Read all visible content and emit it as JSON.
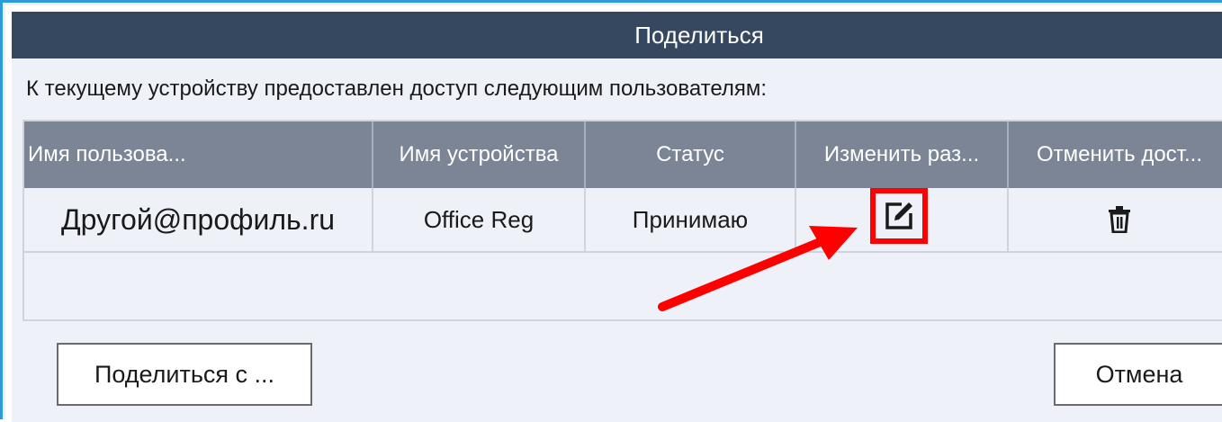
{
  "dialog": {
    "title": "Поделиться",
    "intro_text": "К текущему устройству предоставлен доступ следующим пользователям:"
  },
  "table": {
    "columns": [
      "Имя пользова...",
      "Имя устройства",
      "Статус",
      "Изменить раз...",
      "Отменить дост..."
    ],
    "rows": [
      {
        "user": "Другой@профиль.ru",
        "device": "Office Reg",
        "status": "Принимаю",
        "edit_icon": "edit-icon",
        "revoke_icon": "trash-icon"
      }
    ]
  },
  "buttons": {
    "share_with": "Поделиться с ...",
    "cancel": "Отмена"
  },
  "annotation": {
    "color": "#ff0000"
  }
}
